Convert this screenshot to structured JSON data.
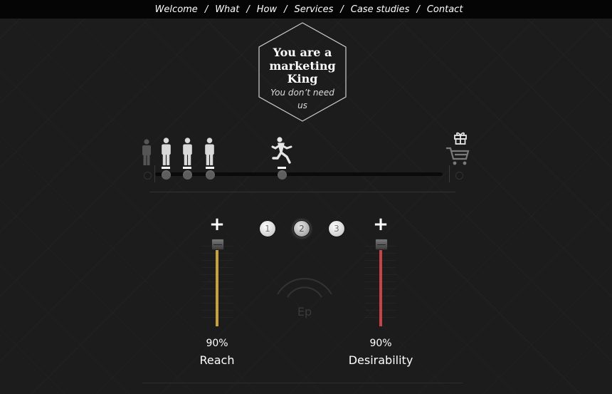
{
  "nav": {
    "items": [
      {
        "label": "Welcome"
      },
      {
        "label": "What"
      },
      {
        "label": "How"
      },
      {
        "label": "Services"
      },
      {
        "label": "Case studies"
      },
      {
        "label": "Contact"
      }
    ],
    "separator": "/"
  },
  "badge": {
    "title_lines": [
      "You are a",
      "marketing",
      "King"
    ],
    "subtitle_lines": [
      "You don’t need",
      "us"
    ]
  },
  "timeline": {
    "people": [
      {
        "icon": "person-standing-icon",
        "active": false
      },
      {
        "icon": "person-standing-icon",
        "active": true
      },
      {
        "icon": "person-standing-icon",
        "active": true
      },
      {
        "icon": "person-standing-icon",
        "active": true
      },
      {
        "icon": "person-running-icon",
        "active": true
      }
    ],
    "end_icons": [
      "gift-icon",
      "shopping-cart-icon"
    ]
  },
  "steps": [
    {
      "label": "1",
      "active": false
    },
    {
      "label": "2",
      "active": true
    },
    {
      "label": "3",
      "active": false
    }
  ],
  "sliders": {
    "reach": {
      "value": "90%",
      "label": "Reach",
      "color": "#c9a13a",
      "level": 0.9,
      "plus": "+"
    },
    "desirability": {
      "value": "90%",
      "label": "Desirability",
      "color": "#c8424a",
      "level": 0.9,
      "plus": "+"
    }
  },
  "center_mark": {
    "text": "Ep",
    "icon": "signal-arc-icon"
  }
}
